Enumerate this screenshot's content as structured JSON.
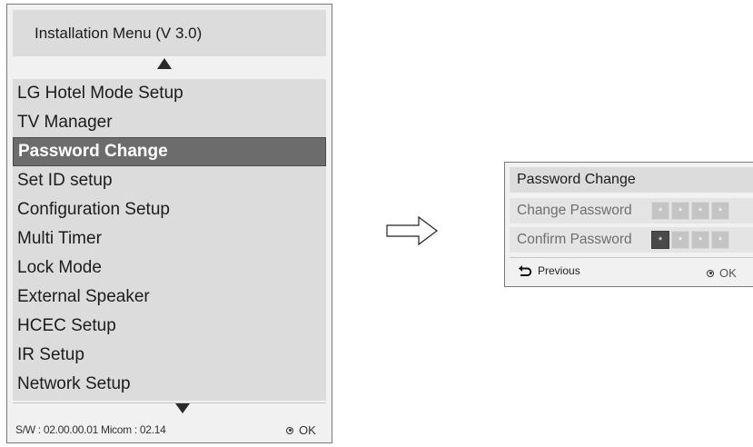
{
  "menu": {
    "title": "Installation Menu (V 3.0)",
    "items": [
      {
        "label": "LG Hotel Mode Setup"
      },
      {
        "label": "TV Manager"
      },
      {
        "label": "Password Change",
        "selected": true
      },
      {
        "label": "Set ID setup"
      },
      {
        "label": "Configuration Setup"
      },
      {
        "label": "Multi Timer"
      },
      {
        "label": "Lock Mode"
      },
      {
        "label": "External Speaker"
      },
      {
        "label": "HCEC Setup"
      },
      {
        "label": "IR Setup"
      },
      {
        "label": "Network Setup"
      }
    ],
    "footer": "S/W : 02.00.00.01 Micom : 02.14",
    "ok_label": "OK"
  },
  "dialog": {
    "title": "Password Change",
    "change_label": "Change Password",
    "confirm_label": "Confirm Password",
    "pin_char": "*",
    "previous_label": "Previous",
    "ok_label": "OK"
  },
  "colors": {
    "panel_bg": "#f1f1f1",
    "list_bg": "#dcdcdc",
    "selected_bg": "#6c6c6c",
    "pin_bg": "#c4c4c4",
    "pin_active_bg": "#4a4a4a"
  }
}
